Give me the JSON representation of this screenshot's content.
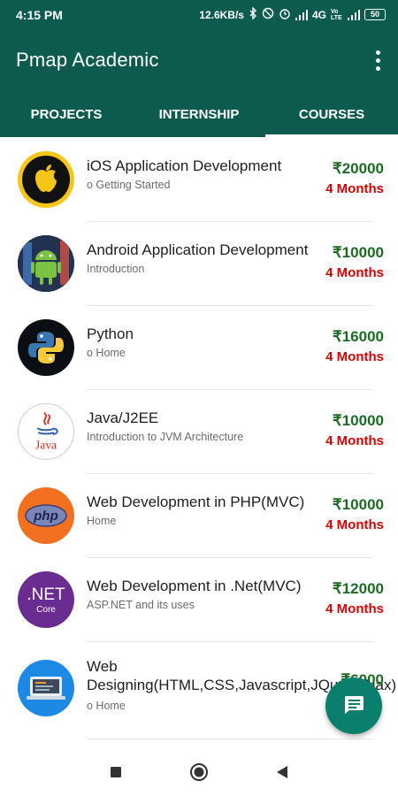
{
  "status_bar": {
    "time": "4:15 PM",
    "speed": "12.6KB/s",
    "network": "4G",
    "volte": "Vo LTE",
    "battery": "50"
  },
  "app": {
    "title": "Pmap Academic"
  },
  "tabs": [
    {
      "label": "PROJECTS",
      "active": false
    },
    {
      "label": "INTERNSHIP",
      "active": false
    },
    {
      "label": "COURSES",
      "active": true
    }
  ],
  "courses": [
    {
      "title": "iOS Application Development",
      "subtitle": "o Getting Started",
      "price": "₹20000",
      "duration": "4 Months",
      "icon": "apple-logo-icon"
    },
    {
      "title": "Android Application Development",
      "subtitle": "Introduction",
      "price": "₹10000",
      "duration": "4 Months",
      "icon": "android-logo-icon"
    },
    {
      "title": "Python",
      "subtitle": "o Home",
      "price": "₹16000",
      "duration": "4 Months",
      "icon": "python-logo-icon"
    },
    {
      "title": "Java/J2EE",
      "subtitle": "Introduction to JVM Architecture",
      "price": "₹10000",
      "duration": "4 Months",
      "icon": "java-logo-icon"
    },
    {
      "title": "Web Development in PHP(MVC)",
      "subtitle": "Home",
      "price": "₹10000",
      "duration": "4 Months",
      "icon": "php-logo-icon"
    },
    {
      "title": "Web Development in .Net(MVC)",
      "subtitle": "ASP.NET and its uses",
      "price": "₹12000",
      "duration": "4 Months",
      "icon": "dotnet-core-logo-icon"
    },
    {
      "title": "Web Designing(HTML,CSS,Javascript,JQuery,Ajax)",
      "subtitle": "o Home",
      "price": "₹6000",
      "duration": "",
      "icon": "web-design-monitor-icon"
    }
  ],
  "logo_text": {
    "java": "Java",
    "php": "php",
    "dotnet_top": ".NET",
    "dotnet_bottom": "Core"
  },
  "colors": {
    "primary": "#0d5b4f",
    "fab": "#0b7f6d",
    "price": "#1b6b24",
    "duration": "#d50000"
  },
  "fab": {
    "icon": "chat-icon"
  },
  "nav": {
    "recents": "square-icon",
    "home": "circle-icon",
    "back": "triangle-back-icon"
  }
}
